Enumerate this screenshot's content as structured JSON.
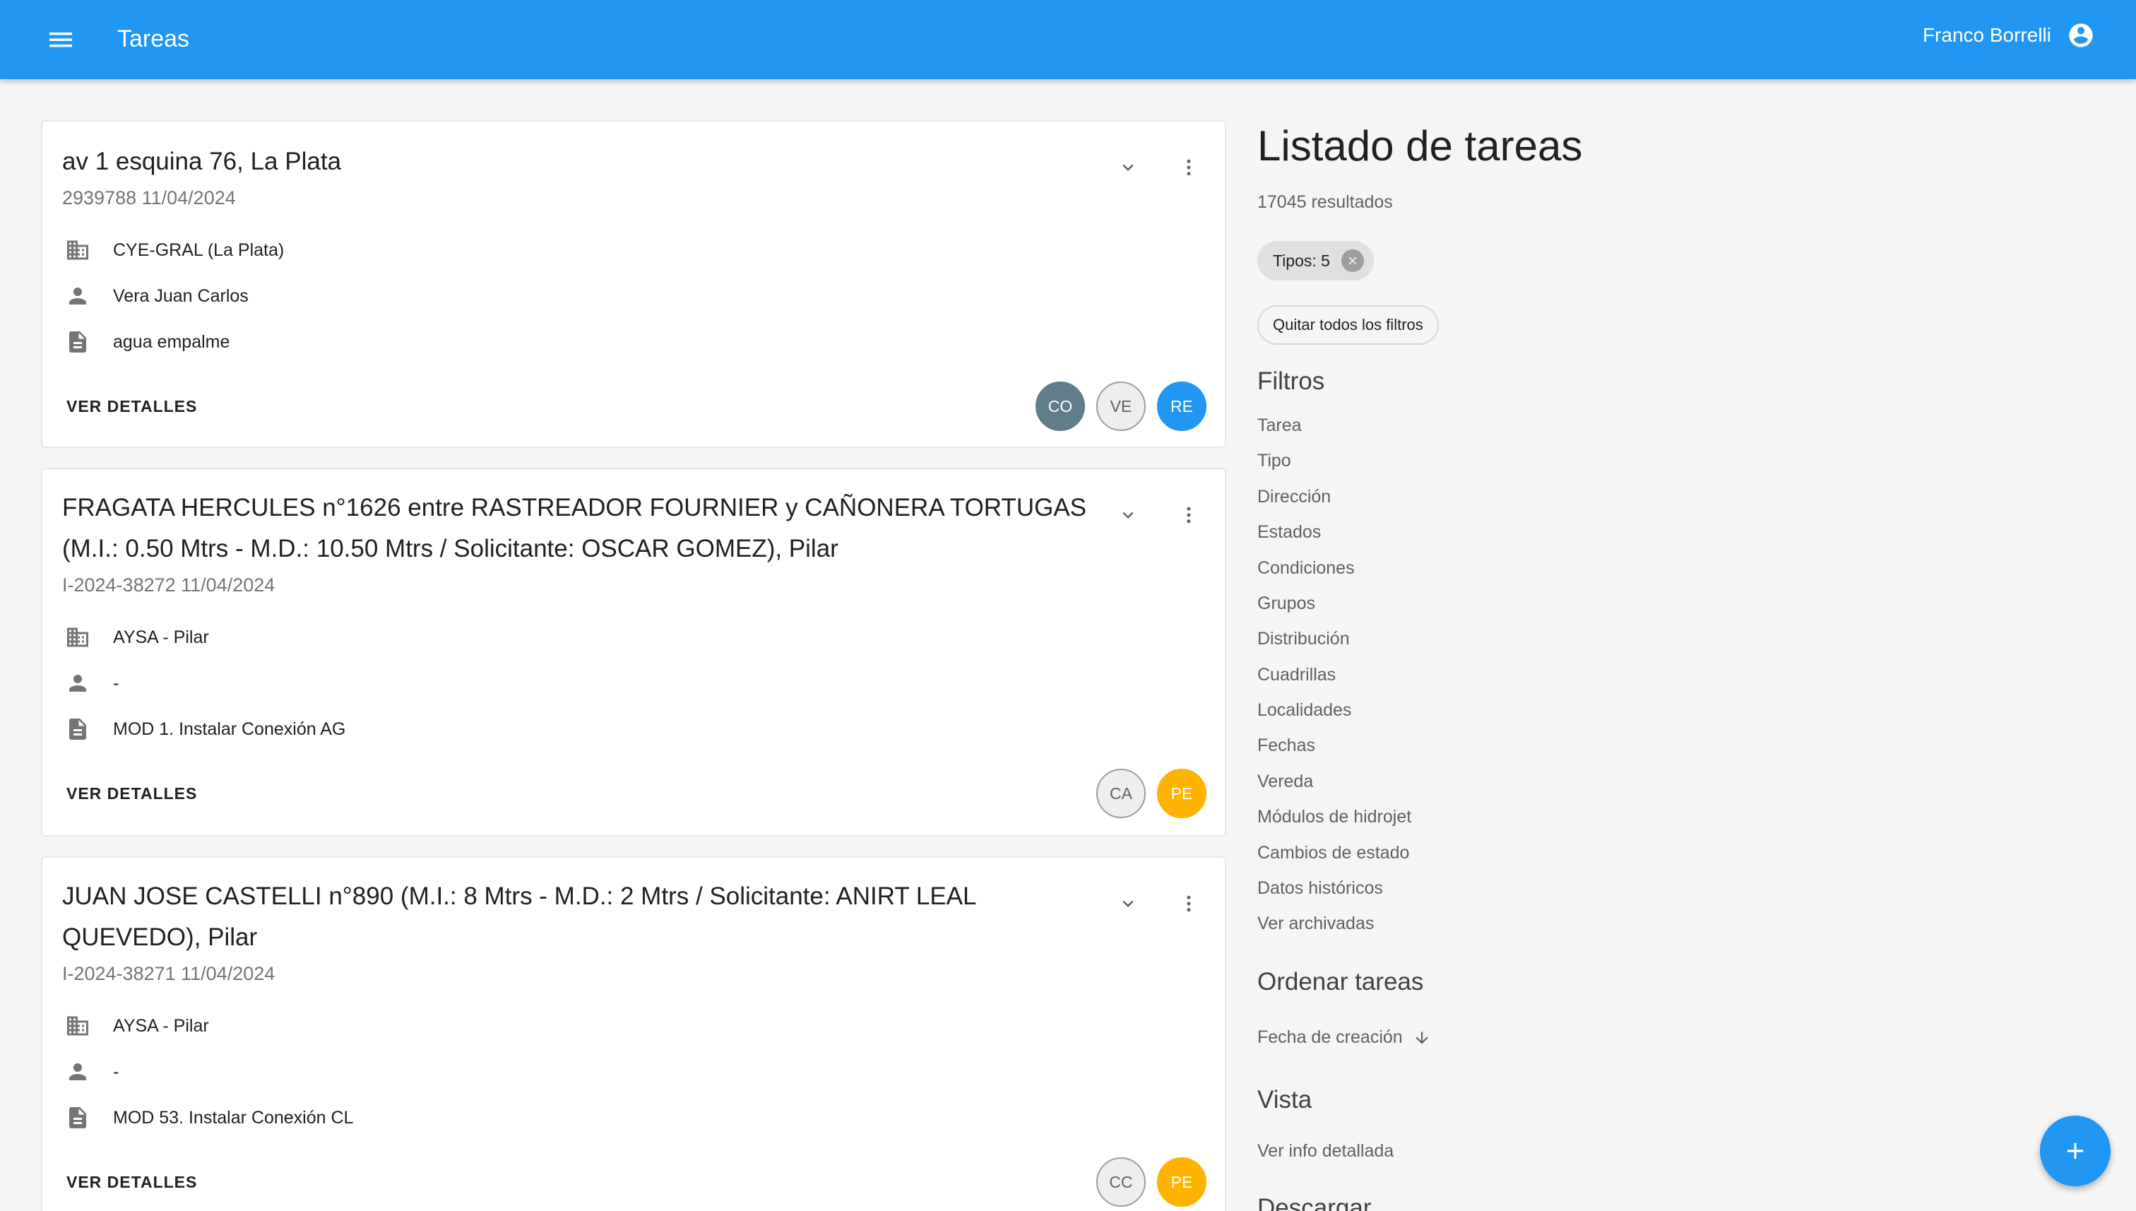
{
  "appbar": {
    "title": "Tareas",
    "user_name": "Franco Borrelli",
    "menu_icon": "menu-icon",
    "user_icon": "account-circle-icon",
    "color": "#2196f3"
  },
  "cards": [
    {
      "title": "av 1 esquina 76, La Plata",
      "subtitle": "2939788 11/04/2024",
      "company": "CYE-GRAL (La Plata)",
      "person": "Vera Juan Carlos",
      "description": "agua empalme",
      "details_label": "VER DETALLES",
      "avatars": [
        {
          "label": "CO",
          "color": "#607d8b"
        },
        {
          "label": "VE",
          "color": "#eeeeee"
        },
        {
          "label": "RE",
          "color": "#2196f3"
        }
      ]
    },
    {
      "title": "FRAGATA HERCULES n°1626 entre RASTREADOR FOURNIER y CAÑONERA TORTUGAS (M.I.: 0.50 Mtrs - M.D.: 10.50 Mtrs / Solicitante: OSCAR GOMEZ), Pilar",
      "subtitle": "I-2024-38272 11/04/2024",
      "company": "AYSA - Pilar",
      "person": "-",
      "description": "MOD 1. Instalar Conexión AG",
      "details_label": "VER DETALLES",
      "avatars": [
        {
          "label": "CA",
          "color": "#eeeeee"
        },
        {
          "label": "PE",
          "color": "#ffb300"
        }
      ]
    },
    {
      "title": "JUAN JOSE CASTELLI n°890 (M.I.: 8 Mtrs - M.D.: 2 Mtrs / Solicitante: ANIRT LEAL QUEVEDO), Pilar",
      "subtitle": "I-2024-38271 11/04/2024",
      "company": "AYSA - Pilar",
      "person": "-",
      "description": "MOD 53. Instalar Conexión CL",
      "details_label": "VER DETALLES",
      "avatars": [
        {
          "label": "CC",
          "color": "#eeeeee"
        },
        {
          "label": "PE",
          "color": "#ffb300"
        }
      ]
    }
  ],
  "sidebar": {
    "title": "Listado de tareas",
    "result_count": "17045 resultados",
    "chip_label": "Tipos: 5",
    "clear_filters": "Quitar todos los filtros",
    "filters_heading": "Filtros",
    "filters": [
      "Tarea",
      "Tipo",
      "Dirección",
      "Estados",
      "Condiciones",
      "Grupos",
      "Distribución",
      "Cuadrillas",
      "Localidades",
      "Fechas",
      "Vereda",
      "Módulos de hidrojet",
      "Cambios de estado",
      "Datos históricos",
      "Ver archivadas"
    ],
    "sort_heading": "Ordenar tareas",
    "sort_value": "Fecha de creación",
    "view_heading": "Vista",
    "view_option": "Ver info detallada",
    "download_heading": "Descargar"
  },
  "fab": {
    "icon": "add-icon"
  }
}
